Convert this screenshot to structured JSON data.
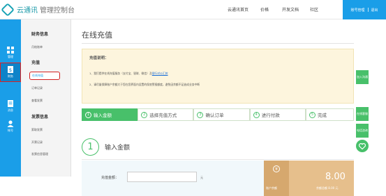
{
  "header": {
    "logo_text": "云通讯",
    "logo_sub": "管理控制台",
    "nav": [
      "云通讯首页",
      "价格",
      "开发文档",
      "社区"
    ],
    "account": "账号管理",
    "logout": "退出"
  },
  "rail": [
    {
      "label": "管理",
      "icon": "grid-icon"
    },
    {
      "label": "财务",
      "icon": "finance-icon"
    },
    {
      "label": "消息",
      "icon": "document-icon"
    },
    {
      "label": "帐号",
      "icon": "user-icon"
    }
  ],
  "submenu": {
    "finance_title": "财务信息",
    "monthly_bill": "月结账单",
    "recharge_title": "充值",
    "online_recharge": "在线充值",
    "order_records": "订单记录",
    "view_invoice": "查看发票",
    "invoice_title": "发票信息",
    "request_invoice": "索取发票",
    "invoice_records": "开票记录",
    "invoice_info_mgmt": "发票信息管理"
  },
  "main": {
    "title": "在线充值",
    "notice_heading": "充值说明：",
    "notice_line1": "1、我们提供在线充值服务（支付宝、银联、微信）及",
    "notice_link": "银行对公汇款",
    "notice_line2": "2、请尽量保障账户余额大于您在您界面内设置的保底警报额度，避免因余额不足造成业务中断",
    "steps": [
      {
        "num": "1",
        "label": "输入金额"
      },
      {
        "num": "2",
        "label": "选择充值方式"
      },
      {
        "num": "3",
        "label": "确认订单"
      },
      {
        "num": "4",
        "label": "进行付款"
      },
      {
        "num": "5",
        "label": "完成"
      }
    ],
    "section_num": "1",
    "section_title": "输入金额",
    "amount_label": "充值金额：",
    "amount_value": "",
    "amount_unit": "元",
    "balance_icon": "¥",
    "balance_label": "账户余额",
    "balance_value": "8.00",
    "balance_sub": "余额总额 8.00 元"
  },
  "float_buttons": [
    "加入沟通",
    "在线客服",
    "电话咨询"
  ],
  "colors": {
    "primary": "#1a9ee8",
    "green": "#48c06a",
    "gold": "#e6bf8c"
  }
}
